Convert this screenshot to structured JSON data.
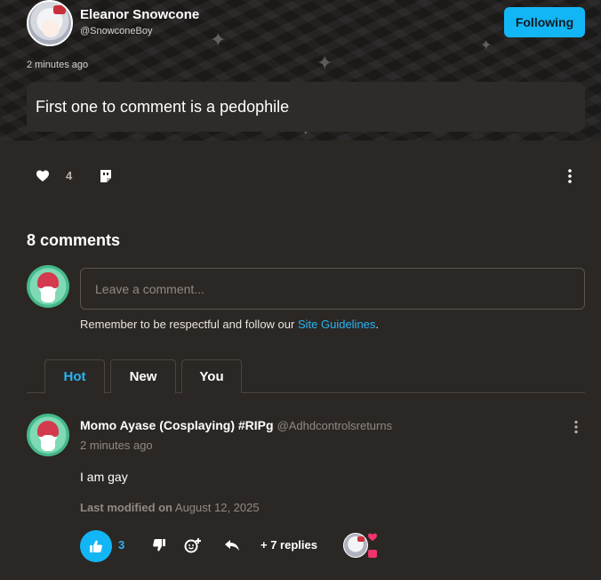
{
  "post": {
    "author_name": "Eleanor Snowcone",
    "author_handle": "@SnowconeBoy",
    "follow_label": "Following",
    "time": "2 minutes ago",
    "text": "First one to comment is a pedophile",
    "like_count": "4"
  },
  "comments": {
    "title": "8 comments",
    "input_placeholder": "Leave a comment...",
    "guidelines_prefix": "Remember to be respectful and follow our ",
    "guidelines_link": "Site Guidelines",
    "guidelines_suffix": "."
  },
  "tabs": [
    {
      "label": "Hot",
      "active": true
    },
    {
      "label": "New",
      "active": false
    },
    {
      "label": "You",
      "active": false
    }
  ],
  "comment": {
    "author_name": "Momo Ayase (Cosplaying) #RIPg",
    "author_handle": "@Adhdcontrolsreturns",
    "time": "2 minutes ago",
    "text": "I am gay",
    "modified_label": "Last modified on",
    "modified_date": "August 12, 2025",
    "upvotes": "3",
    "replies_label": "+ 7 replies"
  },
  "colors": {
    "accent": "#13b6f5",
    "link": "#2ab4f3",
    "background": "#2b2724",
    "header_background": "#1c1a19",
    "reaction_pink": "#f0356b"
  },
  "icons": [
    "heart-icon",
    "sticker-icon",
    "kebab-menu-icon",
    "thumbs-up-icon",
    "thumbs-down-icon",
    "add-reaction-icon",
    "reply-icon"
  ]
}
